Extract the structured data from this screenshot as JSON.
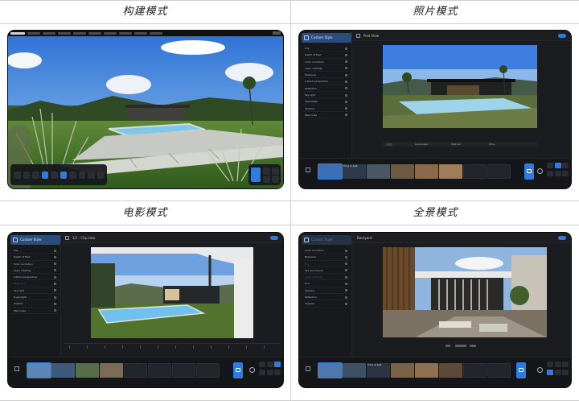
{
  "captions": {
    "top_left": "构建模式",
    "top_right": "照片模式",
    "bottom_left": "电影模式",
    "bottom_right": "全景模式"
  },
  "photo_mode": {
    "panel_title": "Custom Style",
    "view_title": "Post View",
    "effects": [
      "Fog",
      "Depth of field",
      "Color correction",
      "Layer visibility",
      "Exposure",
      "2-Point perspective",
      "Reflection",
      "Sky light",
      "Hyperlight",
      "Shadow",
      "Mist noise"
    ],
    "ctrl_labels": [
      "Landscape",
      "Medium",
      "Ultra"
    ],
    "thumb_label": "Focus on light"
  },
  "movie_mode": {
    "panel_title": "Custom Style",
    "view_title": "1/1 - Clip intro",
    "effects": [
      "Fog",
      "Depth of field",
      "Color correction",
      "Layer visibility",
      "2-Point perspective",
      "Reflection",
      "Sky light",
      "Hyperlight",
      "Shadow",
      "Mist noise"
    ]
  },
  "pano_mode": {
    "panel_title": "Custom Style",
    "view_title": "Backyard",
    "effects": [
      "Color correction",
      "Exposure",
      "Fog",
      "Sky and clouds",
      "Layer visibility",
      "Sun",
      "Shadow",
      "Reflection",
      "Shadow"
    ],
    "thumb_label": "Focus on light"
  },
  "colors": {
    "accent": "#2f7be0",
    "app_bg": "#1a1c20",
    "sidebar_bg": "#17191d"
  }
}
